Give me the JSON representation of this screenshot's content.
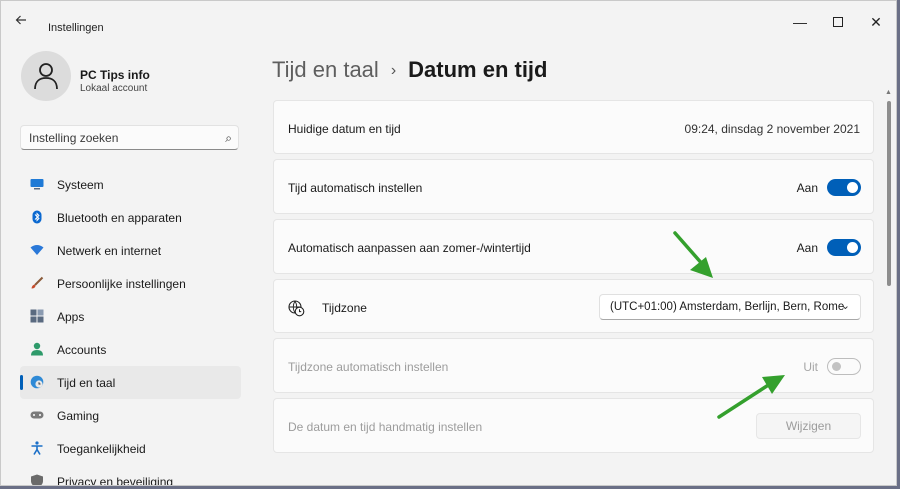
{
  "window": {
    "title": "Instellingen"
  },
  "profile": {
    "name": "PC Tips info",
    "account": "Lokaal account"
  },
  "search": {
    "placeholder": "Instelling zoeken"
  },
  "nav": [
    {
      "label": "Systeem",
      "icon": "monitor-icon",
      "color": "#1f7ad6"
    },
    {
      "label": "Bluetooth en apparaten",
      "icon": "bluetooth-icon",
      "color": "#0a68d0"
    },
    {
      "label": "Netwerk en internet",
      "icon": "wifi-icon",
      "color": "#2a78d8"
    },
    {
      "label": "Persoonlijke instellingen",
      "icon": "brush-icon",
      "color": "#c84b2a"
    },
    {
      "label": "Apps",
      "icon": "apps-icon",
      "color": "#5a6a80"
    },
    {
      "label": "Accounts",
      "icon": "person-icon",
      "color": "#2e9a6a"
    },
    {
      "label": "Tijd en taal",
      "icon": "globe-clock-icon",
      "color": "#2f8ad6",
      "active": true
    },
    {
      "label": "Gaming",
      "icon": "gamepad-icon",
      "color": "#7a7a7a"
    },
    {
      "label": "Toegankelijkheid",
      "icon": "accessibility-icon",
      "color": "#1a6fc8"
    },
    {
      "label": "Privacy en beveiliging",
      "icon": "shield-icon",
      "color": "#6a6a6a"
    }
  ],
  "breadcrumb": {
    "parent": "Tijd en taal",
    "separator": "›",
    "current": "Datum en tijd"
  },
  "cards": {
    "current": {
      "label": "Huidige datum en tijd",
      "value": "09:24, dinsdag 2 november 2021"
    },
    "auto_time": {
      "label": "Tijd automatisch instellen",
      "state": "Aan",
      "on": true
    },
    "dst": {
      "label": "Automatisch aanpassen aan zomer-/wintertijd",
      "state": "Aan",
      "on": true
    },
    "timezone": {
      "label": "Tijdzone",
      "value": "(UTC+01:00) Amsterdam, Berlijn, Bern, Rome"
    },
    "auto_tz": {
      "label": "Tijdzone automatisch instellen",
      "state": "Uit",
      "on": false
    },
    "manual": {
      "label": "De datum en tijd handmatig instellen",
      "button": "Wijzigen"
    }
  },
  "colors": {
    "accent": "#005fb8",
    "annotation_arrow": "#34a02d"
  }
}
